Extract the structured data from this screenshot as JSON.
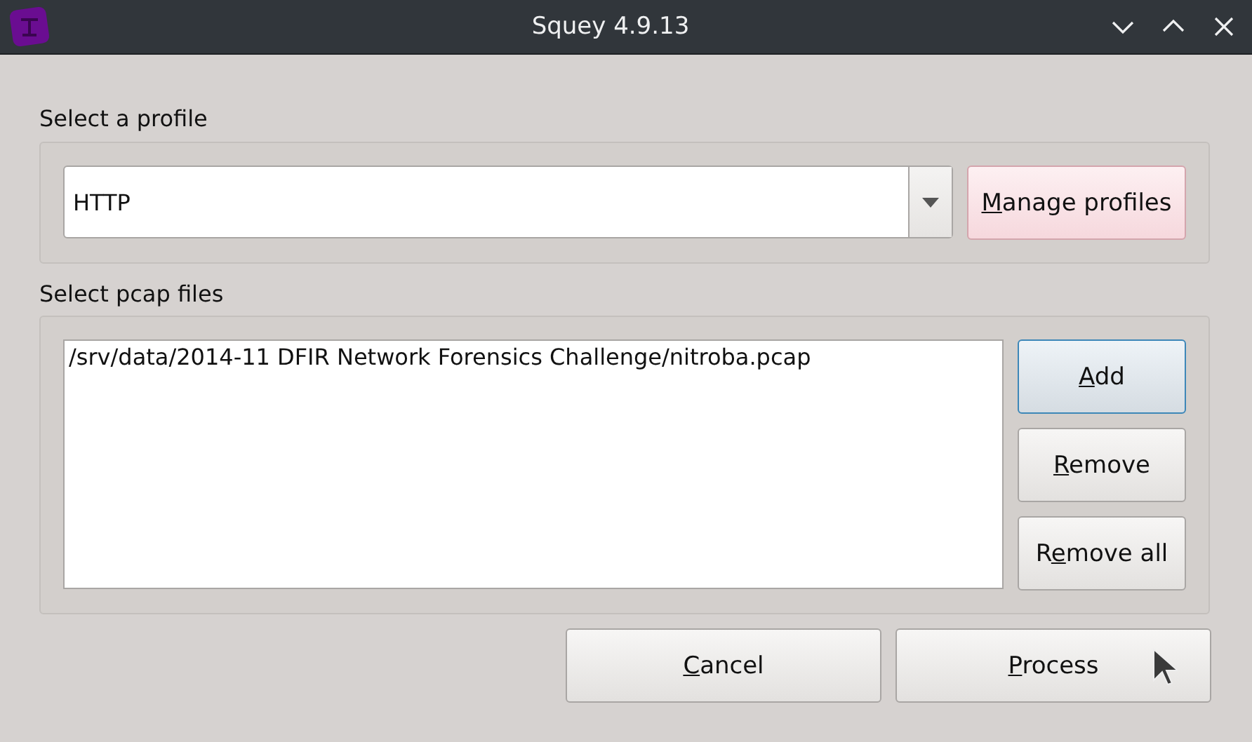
{
  "window": {
    "title": "Squey 4.9.13"
  },
  "profile_section": {
    "label": "Select a profile",
    "profile": {
      "value": "HTTP"
    },
    "button": {
      "label": {
        "mnemonic": "M",
        "after": "anage profiles"
      },
      "hovered": true,
      "focused": false
    }
  },
  "files_section": {
    "label": "Select pcap files",
    "files": [
      {
        "path": "/srv/data/2014-11 DFIR Network Forensics Challenge/nitroba.pcap",
        "selected": false
      }
    ],
    "buttons": [
      {
        "label": {
          "mnemonic": "A",
          "after": "dd"
        },
        "hovered": false,
        "focused": true
      },
      {
        "label": {
          "mnemonic": "R",
          "after": "emove"
        },
        "hovered": false,
        "focused": false
      },
      {
        "label": {
          "before": "R",
          "mnemonic": "e",
          "after": "move all"
        },
        "hovered": false,
        "focused": false
      }
    ]
  },
  "buttons": [
    {
      "label": {
        "mnemonic": "C",
        "after": "ancel"
      },
      "hovered": false,
      "focused": false
    },
    {
      "label": {
        "mnemonic": "P",
        "after": "rocess"
      },
      "hovered": false,
      "focused": false
    }
  ]
}
